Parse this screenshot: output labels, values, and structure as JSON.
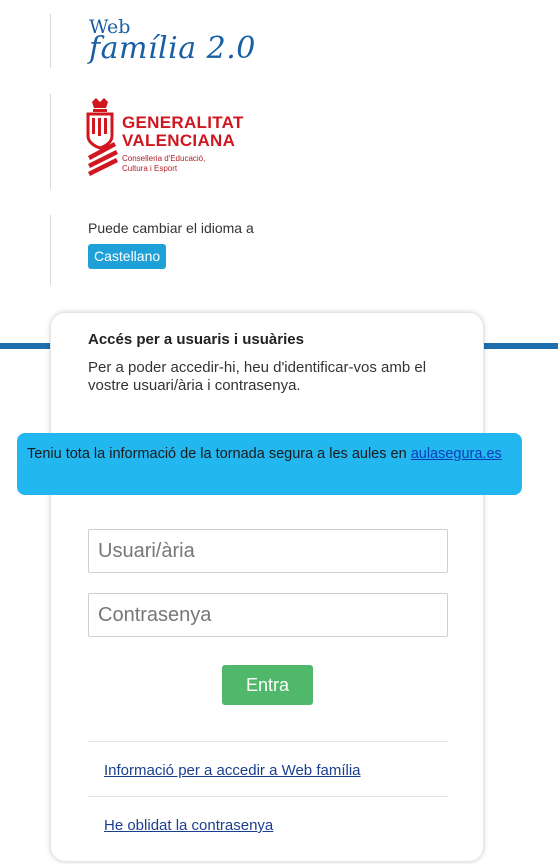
{
  "logo": {
    "line1": "Web",
    "line2": "família 2.0"
  },
  "gva": {
    "line1": "GENERALITAT",
    "line2": "VALENCIANA",
    "sub1": "Conselleria d'Educació,",
    "sub2": "Cultura i Esport"
  },
  "language": {
    "prompt": "Puede cambiar el idioma a",
    "button": "Castellano"
  },
  "login": {
    "title": "Accés per a usuaris i usuàries",
    "description": "Per a poder accedir-hi, heu d'identificar-vos amb el vostre usuari/ària i contrasenya.",
    "username_placeholder": "Usuari/ària",
    "password_placeholder": "Contrasenya",
    "submit": "Entra",
    "link_info": "Informació per a accedir a Web família",
    "link_forgot": "He oblidat la contrasenya"
  },
  "banner": {
    "text": "Teniu tota la informació de la tornada segura a les aules en ",
    "link": "aulasegura.es"
  },
  "colors": {
    "accent": "#22b7ef",
    "brand_blue": "#1a5fa6",
    "gva_red": "#d0171f",
    "submit": "#4fb86b"
  }
}
